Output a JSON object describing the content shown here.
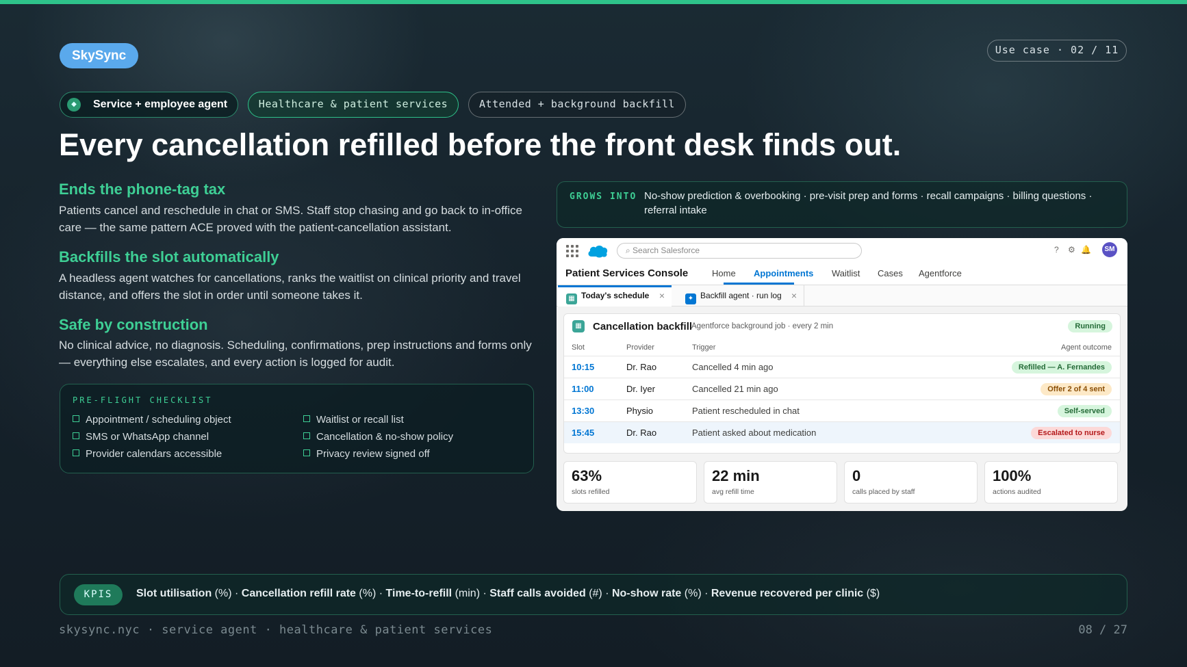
{
  "slide": {
    "brand": "SkySync",
    "use_case": "Use case · 02 / 11",
    "tags": [
      "Service + employee agent",
      "Healthcare & patient services",
      "Attended + background backfill"
    ],
    "headline": "Every cancellation refilled before the front desk finds out.",
    "sections": [
      {
        "title": "Ends the phone-tag tax",
        "body": "Patients cancel and reschedule in chat or SMS. Staff stop chasing and go back to in-office care — the same pattern ACE proved with the patient-cancellation assistant."
      },
      {
        "title": "Backfills the slot automatically",
        "body": "A headless agent watches for cancellations, ranks the waitlist on clinical priority and travel distance, and offers the slot in order until someone takes it."
      },
      {
        "title": "Safe by construction",
        "body": "No clinical advice, no diagnosis. Scheduling, confirmations, prep instructions and forms only — everything else escalates, and every action is logged for audit."
      }
    ],
    "checklist": {
      "title": "PRE-FLIGHT CHECKLIST",
      "items": [
        "Appointment / scheduling object",
        "SMS or WhatsApp channel",
        "Provider calendars accessible",
        "Waitlist or recall list",
        "Cancellation & no-show policy",
        "Privacy review signed off"
      ]
    },
    "grows_into": {
      "label": "GROWS INTO",
      "text": "No-show prediction & overbooking · pre-visit prep and forms · recall campaigns · billing questions · referral intake"
    },
    "kpis": {
      "label": "KPIS",
      "items": [
        {
          "name": "Slot utilisation",
          "unit": "(%)"
        },
        {
          "name": "Cancellation refill rate",
          "unit": "(%)"
        },
        {
          "name": "Time-to-refill",
          "unit": "(min)"
        },
        {
          "name": "Staff calls avoided",
          "unit": "(#)"
        },
        {
          "name": "No-show rate",
          "unit": "(%)"
        },
        {
          "name": "Revenue recovered per clinic",
          "unit": "($)"
        }
      ]
    },
    "footer": "skysync.nyc · service agent · healthcare & patient services",
    "page": "08 / 27"
  },
  "salesforce": {
    "search_placeholder": "⌕ Search Salesforce",
    "avatar": "SM",
    "app_name": "Patient Services Console",
    "nav": [
      "Home",
      "Appointments",
      "Waitlist",
      "Cases",
      "Agentforce"
    ],
    "active_nav": "Appointments",
    "tabs": [
      "Today's schedule",
      "Backfill agent · run log"
    ],
    "card": {
      "title": "Cancellation backfill",
      "subtitle": "Agentforce background job · every 2 min",
      "status": "Running",
      "columns": [
        "Slot",
        "Provider",
        "Trigger",
        "Agent outcome"
      ],
      "rows": [
        {
          "slot": "10:15",
          "provider": "Dr. Rao",
          "trigger": "Cancelled 4 min ago",
          "outcome": "Refilled — A. Fernandes",
          "tone": "g"
        },
        {
          "slot": "11:00",
          "provider": "Dr. Iyer",
          "trigger": "Cancelled 21 min ago",
          "outcome": "Offer 2 of 4 sent",
          "tone": "o"
        },
        {
          "slot": "13:30",
          "provider": "Physio",
          "trigger": "Patient rescheduled in chat",
          "outcome": "Self-served",
          "tone": "g"
        },
        {
          "slot": "15:45",
          "provider": "Dr. Rao",
          "trigger": "Patient asked about medication",
          "outcome": "Escalated to nurse",
          "tone": "r"
        }
      ]
    },
    "stats": [
      {
        "value": "63%",
        "label": "slots refilled"
      },
      {
        "value": "22 min",
        "label": "avg refill time"
      },
      {
        "value": "0",
        "label": "calls placed by staff"
      },
      {
        "value": "100%",
        "label": "actions audited"
      }
    ]
  },
  "colors": {
    "accent": "#2ec28a",
    "salesforce_blue": "#0176d3",
    "brand_pill": "#5aa9ec"
  }
}
